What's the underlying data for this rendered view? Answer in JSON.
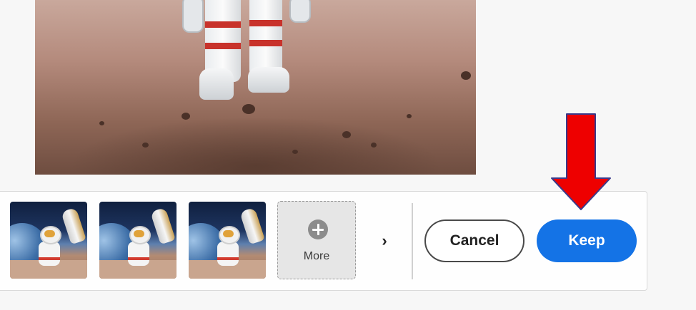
{
  "preview": {
    "alt": ""
  },
  "variations": {
    "thumbnails": [
      {
        "id": 1
      },
      {
        "id": 2
      },
      {
        "id": 3
      }
    ],
    "more_label": "More",
    "next_glyph": "›"
  },
  "actions": {
    "cancel_label": "Cancel",
    "keep_label": "Keep"
  },
  "colors": {
    "accent": "#1473e6",
    "annotation_arrow": "#ee0000"
  },
  "icons": {
    "more": "plus-circle-icon",
    "next": "chevron-right-icon",
    "annotation": "down-arrow-icon"
  }
}
